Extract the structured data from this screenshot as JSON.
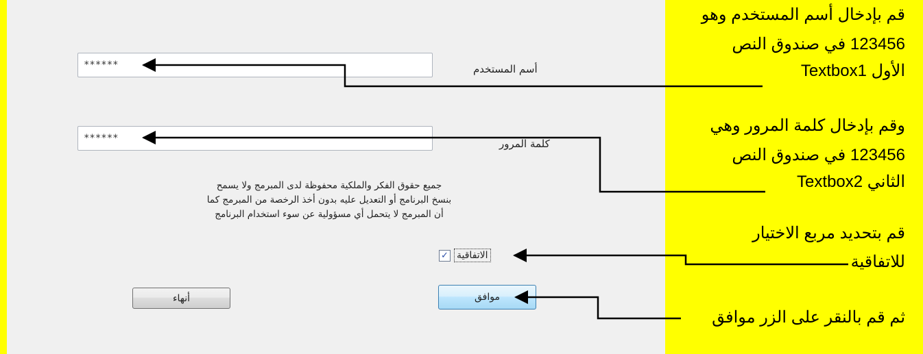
{
  "form": {
    "username_label": "أسم المستخدم",
    "username_value": "******",
    "password_label": "كلمة المرور",
    "password_value": "******",
    "notice_lines": [
      "جميع حقوق الفكر والملكية محفوظة لدى المبرمج ولا يسمح",
      "بنسخ البرنامج أو التعديل عليه بدون أخذ الرخصة من المبرمج كما",
      "أن المبرمج لا يتحمل أي مسؤولية عن سوء استخدام البرنامج"
    ],
    "agree_label": "الاتفاقية",
    "agree_checked": true,
    "ok_button": "موافق",
    "exit_button": "أنهاء"
  },
  "instructions": {
    "step1": [
      "قم بإدخال أسم المستخدم وهو",
      "123456 في صندوق النص",
      "الأول Textbox1"
    ],
    "step2": [
      "وقم بإدخال كلمة المرور وهي",
      "123456 في صندوق النص",
      "الثاني Textbox2"
    ],
    "step3": [
      "قم بتحديد مربع الاختيار",
      "للاتفاقية"
    ],
    "step4": [
      "ثم قم بالنقر على الزر موافق"
    ]
  },
  "colors": {
    "highlight": "#ffff00",
    "form_background": "#f0f0f0",
    "connector": "#000000"
  }
}
